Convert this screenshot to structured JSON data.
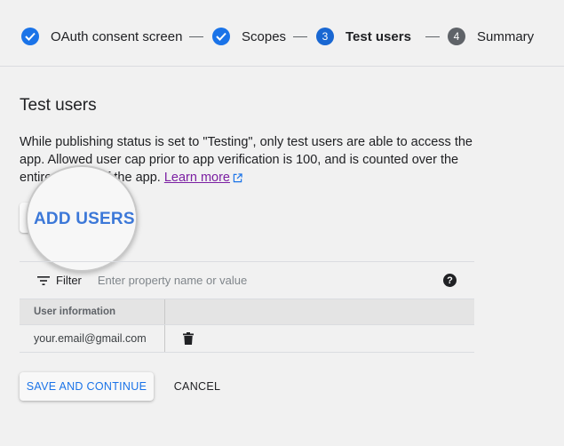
{
  "stepper": {
    "steps": [
      {
        "label": "OAuth consent screen",
        "state": "done",
        "icon": "check-icon"
      },
      {
        "label": "Scopes",
        "state": "done",
        "icon": "check-icon"
      },
      {
        "label": "Test users",
        "state": "current",
        "number": "3"
      },
      {
        "label": "Summary",
        "state": "future",
        "number": "4"
      }
    ]
  },
  "section": {
    "title": "Test users",
    "description_prefix": "While publishing status is set to \"Testing\", only test users are able to access the app. Allowed user cap prior to app verification is 100, and is counted over the entire lifetime of the app. ",
    "learn_more": "Learn more"
  },
  "add_users": {
    "label": "ADD USERS"
  },
  "filter": {
    "label": "Filter",
    "placeholder": "Enter property name or value"
  },
  "table": {
    "headers": [
      "User information",
      ""
    ],
    "rows": [
      {
        "email": "your.email@gmail.com"
      }
    ]
  },
  "actions": {
    "save_label": "SAVE AND CONTINUE",
    "cancel_label": "CANCEL"
  },
  "colors": {
    "accent": "#1a73e8",
    "link_visited": "#7b1fa2",
    "background": "#f1f1f1"
  }
}
